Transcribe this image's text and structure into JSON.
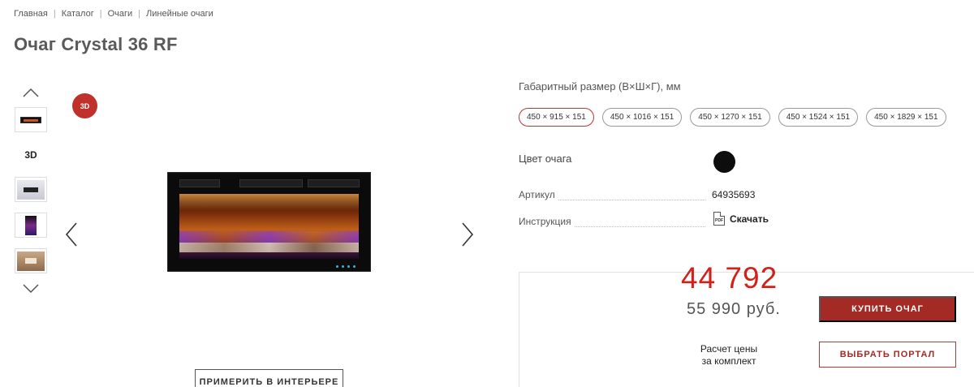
{
  "breadcrumb": [
    "Главная",
    "Каталог",
    "Очаги",
    "Линейные очаги"
  ],
  "title": "Очаг Crystal 36 RF",
  "gallery": {
    "up_icon": "chevron-up-icon",
    "down_icon": "chevron-down-icon",
    "thumb_3d_label": "3D",
    "badge_label": "3D",
    "prev_icon": "chevron-left-icon",
    "next_icon": "chevron-right-icon",
    "try_button": "ПРИМЕРИТЬ В ИНТЕРЬЕРЕ"
  },
  "specs": {
    "size_label": "Габаритный размер (В×Ш×Г), мм",
    "sizes": [
      "450 × 915 × 151",
      "450 × 1016 × 151",
      "450 × 1270 × 151",
      "450 × 1524 × 151",
      "450 × 1829 × 151"
    ],
    "selected_size": "450 × 915 × 151",
    "color_label": "Цвет очага",
    "color_value": "#0d0d0d",
    "article_label": "Артикул",
    "article_value": "64935693",
    "manual_label": "Инструкция",
    "manual_link": "Скачать",
    "pdf_icon_text": "PDF"
  },
  "price": {
    "new": "44 792",
    "old": "55 990 руб.",
    "calc_line1": "Расчет цены",
    "calc_line2": "за комплект",
    "buy_button": "КУПИТЬ ОЧАГ",
    "portal_button": "ВЫБРАТЬ ПОРТАЛ"
  },
  "colors": {
    "accent": "#a32a25",
    "price_red": "#d2201a"
  }
}
